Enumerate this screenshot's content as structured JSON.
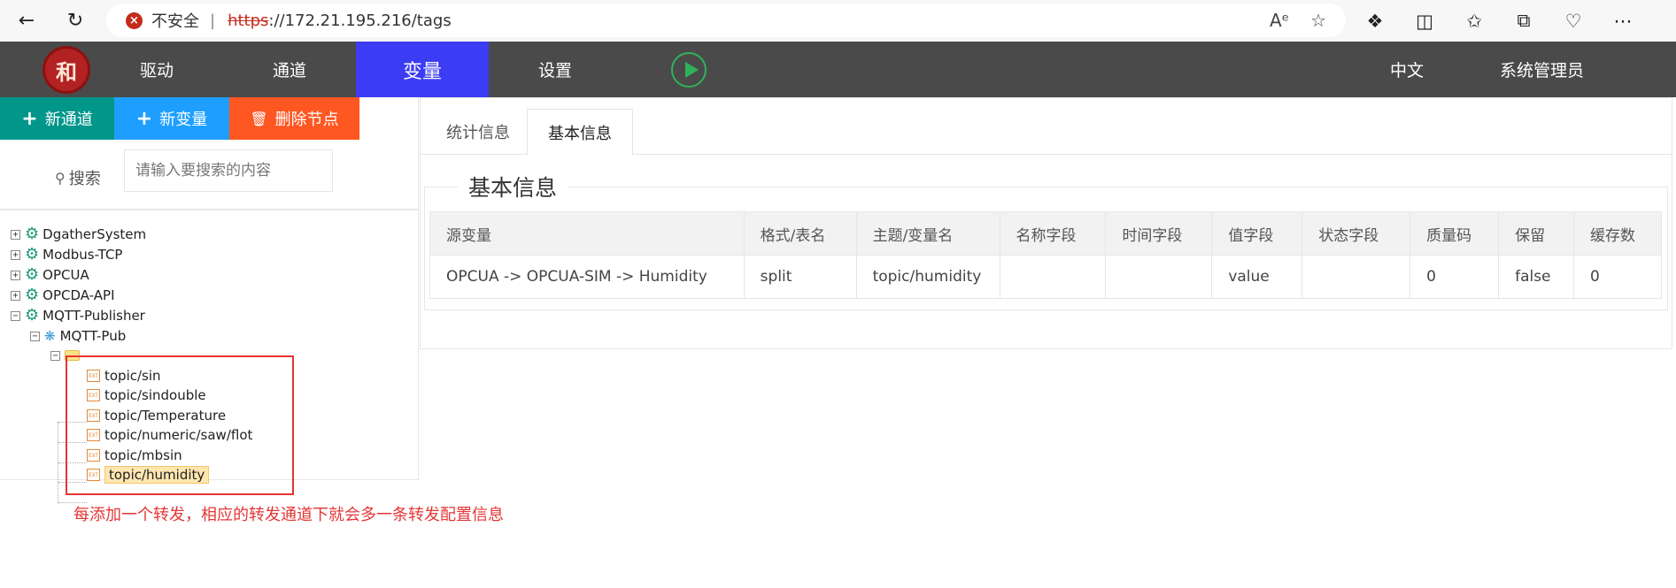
{
  "browser": {
    "insecure_label": "不安全",
    "url_proto": "https",
    "url_rest": "://172.21.195.216/tags"
  },
  "header": {
    "logo_text": "和",
    "menu": [
      {
        "label": "驱动",
        "active": false
      },
      {
        "label": "通道",
        "active": false
      },
      {
        "label": "变量",
        "active": true
      },
      {
        "label": "设置",
        "active": false
      }
    ],
    "language": "中文",
    "user": "系统管理员"
  },
  "actions": {
    "new_channel": "新通道",
    "new_variable": "新变量",
    "delete_node": "删除节点"
  },
  "search": {
    "label": "搜索",
    "placeholder": "请输入要搜索的内容"
  },
  "tree": {
    "roots": [
      "DgatherSystem",
      "Modbus-TCP",
      "OPCUA",
      "OPCDA-API",
      "MQTT-Publisher"
    ],
    "child": "MQTT-Pub",
    "file_icon_text": "EXT",
    "leaves": [
      "topic/sin",
      "topic/sindouble",
      "topic/Temperature",
      "topic/numeric/saw/flot",
      "topic/mbsin",
      "topic/humidity"
    ]
  },
  "annotation": "每添加一个转发，相应的转发通道下就会多一条转发配置信息",
  "tabs": [
    {
      "label": "统计信息",
      "active": false
    },
    {
      "label": "基本信息",
      "active": true
    }
  ],
  "section_title": "基本信息",
  "table": {
    "headers": [
      "源变量",
      "格式/表名",
      "主题/变量名",
      "名称字段",
      "时间字段",
      "值字段",
      "状态字段",
      "质量码",
      "保留",
      "缓存数"
    ],
    "rows": [
      [
        "OPCUA -> OPCUA-SIM -> Humidity",
        "split",
        "topic/humidity",
        "",
        "",
        "value",
        "",
        "0",
        "false",
        "0"
      ]
    ]
  },
  "colors": {
    "header_bg": "#4a4a4a",
    "active_menu": "#3c3cf5",
    "btn_new_channel": "#00968a",
    "btn_new_variable": "#1e9fff",
    "btn_delete": "#ff5722",
    "annotation": "#e53535"
  }
}
